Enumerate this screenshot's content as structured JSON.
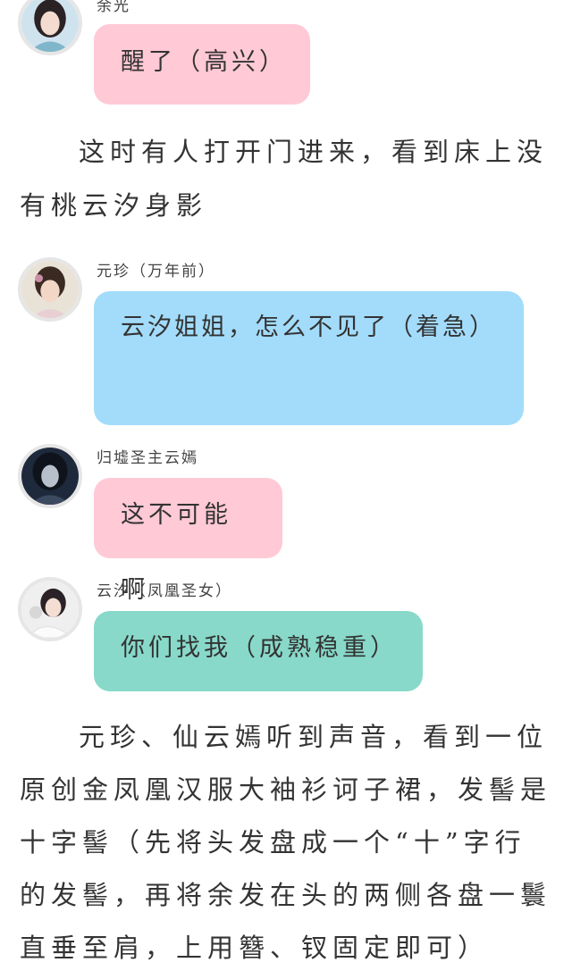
{
  "messages": [
    {
      "name": "余光",
      "text": "醒了（高兴）",
      "bubble_color": "#ffc9d6"
    },
    {
      "name": "元珍（万年前）",
      "text": "云汐姐姐，怎么不见了（着急）",
      "bubble_color": "#a3dcfa"
    },
    {
      "name": "归墟圣主云嫣",
      "text": "这不可能啊",
      "bubble_color": "#ffc9d6"
    },
    {
      "name": "云汐（凤凰圣女）",
      "text": "你们找我（成熟稳重）",
      "bubble_color": "#88d9c9"
    }
  ],
  "narration": [
    "这时有人打开门进来，看到床上没有桃云汐身影",
    "元珍、仙云嫣听到声音，看到一位原创金凤凰汉服大袖衫诃子裙，发髻是十字髻（先将头发盘成一个“十”字行的发髻，再将余发在头的两侧各盘一鬟直垂至肩，上用簪、钗固定即可）"
  ]
}
